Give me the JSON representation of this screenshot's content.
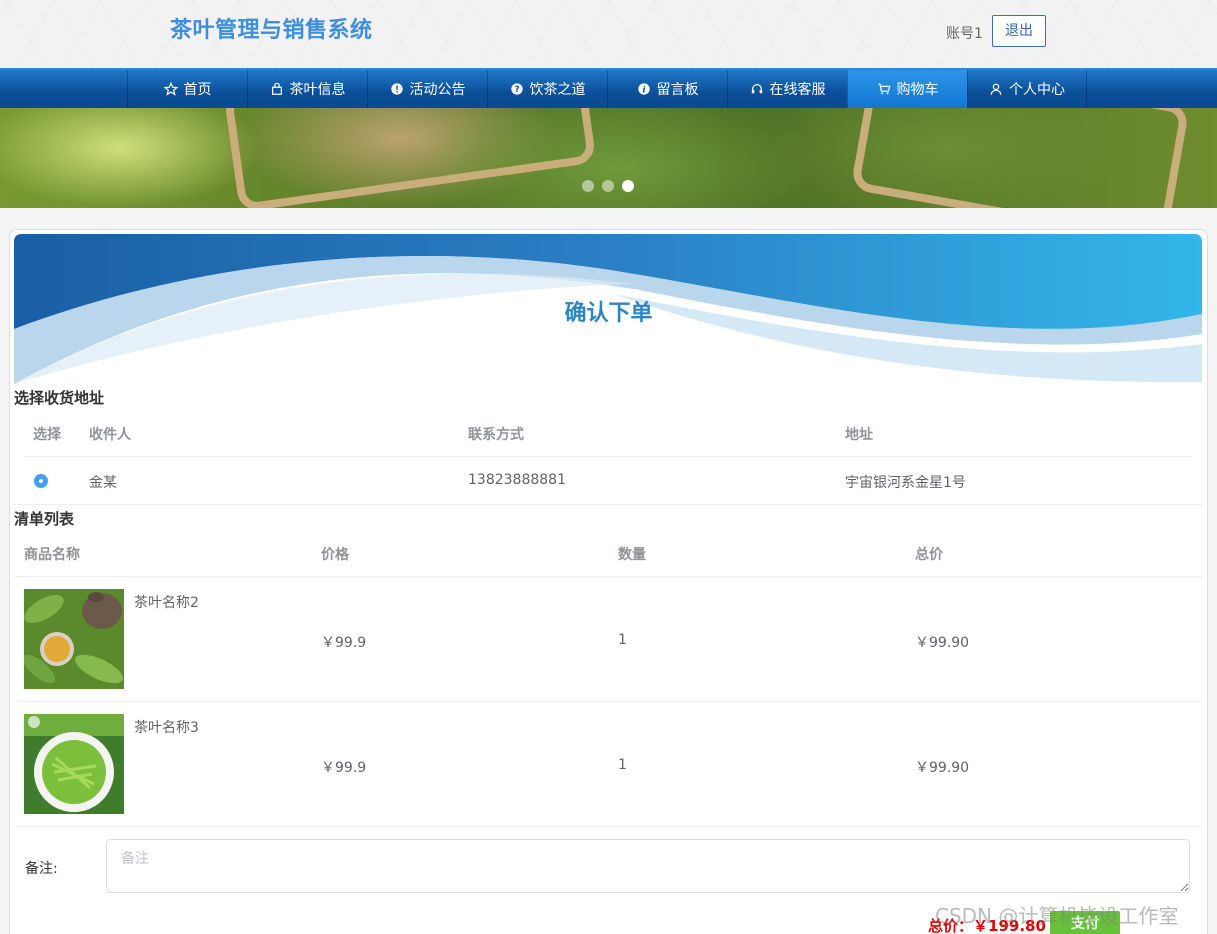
{
  "header": {
    "title": "茶叶管理与销售系统",
    "account": "账号1",
    "logout_label": "退出"
  },
  "nav": {
    "items": [
      {
        "label": "首页",
        "icon": "star-icon"
      },
      {
        "label": "茶叶信息",
        "icon": "bag-icon"
      },
      {
        "label": "活动公告",
        "icon": "alert-icon"
      },
      {
        "label": "饮茶之道",
        "icon": "question-icon"
      },
      {
        "label": "留言板",
        "icon": "info-icon"
      },
      {
        "label": "在线客服",
        "icon": "headset-icon"
      },
      {
        "label": "购物车",
        "icon": "cart-icon"
      },
      {
        "label": "个人中心",
        "icon": "user-icon"
      }
    ],
    "active_label": "购物车"
  },
  "banner": {
    "active_slide": 3,
    "slide_count": 3
  },
  "page": {
    "title": "确认下单"
  },
  "address_section": {
    "label": "选择收货地址",
    "headers": [
      "选择",
      "收件人",
      "联系方式",
      "地址"
    ],
    "rows": [
      {
        "recipient": "金某",
        "phone": "13823888881",
        "address": "宇宙银河系金星1号",
        "selected": true
      }
    ]
  },
  "order_section": {
    "label": "清单列表",
    "headers": [
      "商品名称",
      "价格",
      "数量",
      "总价"
    ],
    "rows": [
      {
        "name": "茶叶名称2",
        "price": "￥99.9",
        "qty": "1",
        "total": "￥99.90"
      },
      {
        "name": "茶叶名称3",
        "price": "￥99.9",
        "qty": "1",
        "total": "￥99.90"
      }
    ]
  },
  "remark": {
    "label": "备注:",
    "placeholder": "备注",
    "value": ""
  },
  "footer": {
    "total_label": "总价：",
    "total_value": "￥199.80",
    "pay_label": "支付",
    "watermark": "CSDN @计算机毕设工作室"
  },
  "colors": {
    "brand": "#3d8ee0",
    "nav": "#0b4f98",
    "accent": "#409eff",
    "pay": "#67c23a",
    "price": "#e30000"
  }
}
